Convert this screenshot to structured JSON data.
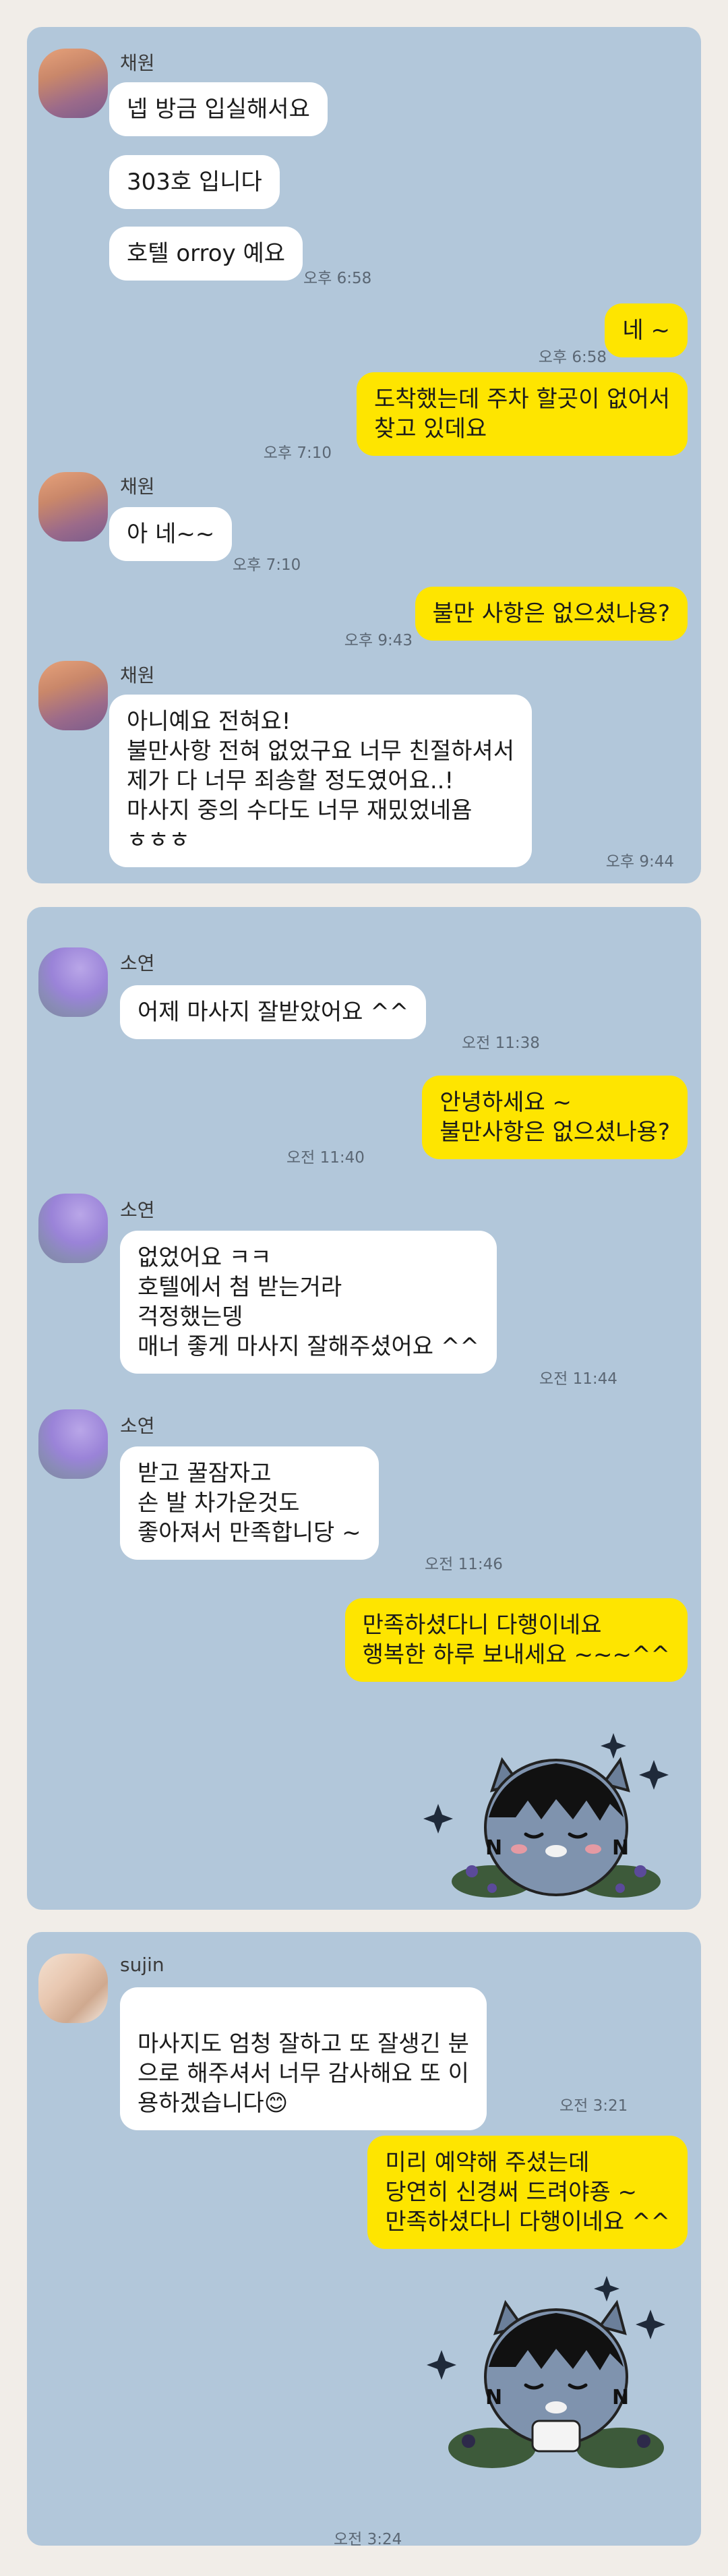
{
  "chat1": {
    "name": "채원",
    "messages": [
      {
        "text": "넵 방금 입실해서요"
      },
      {
        "text": "303호 입니다"
      },
      {
        "text": "호텔 orroy 예요"
      },
      {
        "time": "오후 6:58"
      },
      {
        "text": "네 ~",
        "time": "오후 6:58"
      },
      {
        "text": "도착했는데  주차 할곳이 없어서\n찾고 있데요",
        "time": "오후 7:10"
      },
      {
        "text": "아 네~~",
        "time": "오후 7:10"
      },
      {
        "text": "불만 사항은 없으셨나용?",
        "time": "오후 9:43"
      },
      {
        "text": "아니예요 전혀요!\n불만사항 전혀 없었구요 너무 친절하셔서\n제가 다 너무 죄송할 정도였어요..!\n마사지 중의 수다도 너무 재밌었네욤\nㅎㅎㅎ",
        "time": "오후 9:44"
      }
    ]
  },
  "chat2": {
    "name": "소연",
    "messages": [
      {
        "text": "어제 마사지 잘받았어요 ^^",
        "time": "오전 11:38"
      },
      {
        "text": "안녕하세요 ~\n불만사항은 없으셨나용?",
        "time": "오전 11:40"
      },
      {
        "text": "없었어요 ㅋㅋ\n호텔에서 첨 받는거라\n걱정했는뎅\n매너 좋게 마사지 잘해주셨어요 ^^",
        "time": "오전 11:44"
      },
      {
        "text": "받고 꿀잠자고\n손 발 차가운것도\n좋아져서 만족합니당 ~",
        "time": "오전 11:46"
      },
      {
        "text": "만족하셨다니 다행이네요\n행복한 하루 보내세요 ~~~^^"
      }
    ],
    "sticker": "kakao-frodo-sticker"
  },
  "chat3": {
    "name": "sujin",
    "messages": [
      {
        "text": "마사지도 엄청 잘하고 또 잘생긴 분\n으로 해주셔서 너무 감사해요 또 이\n용하겠습니다",
        "emoji": "😊",
        "time": "오전 3:21"
      },
      {
        "text": "미리 예약해 주셨는데\n당연히 신경써 드려야죵 ~\n만족하셨다니 다행이네요 ^^"
      }
    ],
    "sticker": "kakao-frodo-sticker",
    "last_time": "오전 3:24"
  },
  "colors": {
    "chat_background": "#b2c7da",
    "outgoing_bubble": "#fee500",
    "incoming_bubble": "#ffffff",
    "page_background": "#f1ede8"
  }
}
